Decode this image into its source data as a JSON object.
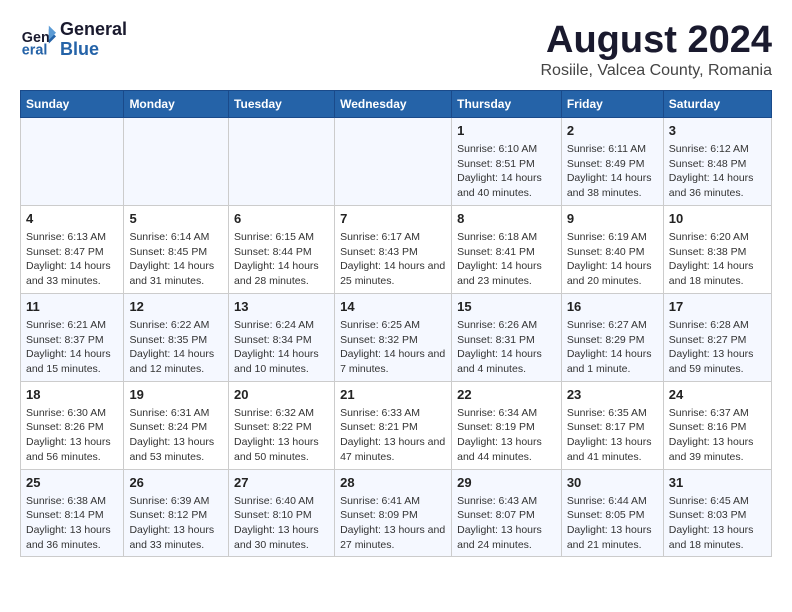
{
  "header": {
    "logo_line1": "General",
    "logo_line2": "Blue",
    "main_title": "August 2024",
    "subtitle": "Rosiile, Valcea County, Romania"
  },
  "days_of_week": [
    "Sunday",
    "Monday",
    "Tuesday",
    "Wednesday",
    "Thursday",
    "Friday",
    "Saturday"
  ],
  "weeks": [
    [
      {
        "day": "",
        "content": ""
      },
      {
        "day": "",
        "content": ""
      },
      {
        "day": "",
        "content": ""
      },
      {
        "day": "",
        "content": ""
      },
      {
        "day": "1",
        "content": "Sunrise: 6:10 AM\nSunset: 8:51 PM\nDaylight: 14 hours and 40 minutes."
      },
      {
        "day": "2",
        "content": "Sunrise: 6:11 AM\nSunset: 8:49 PM\nDaylight: 14 hours and 38 minutes."
      },
      {
        "day": "3",
        "content": "Sunrise: 6:12 AM\nSunset: 8:48 PM\nDaylight: 14 hours and 36 minutes."
      }
    ],
    [
      {
        "day": "4",
        "content": "Sunrise: 6:13 AM\nSunset: 8:47 PM\nDaylight: 14 hours and 33 minutes."
      },
      {
        "day": "5",
        "content": "Sunrise: 6:14 AM\nSunset: 8:45 PM\nDaylight: 14 hours and 31 minutes."
      },
      {
        "day": "6",
        "content": "Sunrise: 6:15 AM\nSunset: 8:44 PM\nDaylight: 14 hours and 28 minutes."
      },
      {
        "day": "7",
        "content": "Sunrise: 6:17 AM\nSunset: 8:43 PM\nDaylight: 14 hours and 25 minutes."
      },
      {
        "day": "8",
        "content": "Sunrise: 6:18 AM\nSunset: 8:41 PM\nDaylight: 14 hours and 23 minutes."
      },
      {
        "day": "9",
        "content": "Sunrise: 6:19 AM\nSunset: 8:40 PM\nDaylight: 14 hours and 20 minutes."
      },
      {
        "day": "10",
        "content": "Sunrise: 6:20 AM\nSunset: 8:38 PM\nDaylight: 14 hours and 18 minutes."
      }
    ],
    [
      {
        "day": "11",
        "content": "Sunrise: 6:21 AM\nSunset: 8:37 PM\nDaylight: 14 hours and 15 minutes."
      },
      {
        "day": "12",
        "content": "Sunrise: 6:22 AM\nSunset: 8:35 PM\nDaylight: 14 hours and 12 minutes."
      },
      {
        "day": "13",
        "content": "Sunrise: 6:24 AM\nSunset: 8:34 PM\nDaylight: 14 hours and 10 minutes."
      },
      {
        "day": "14",
        "content": "Sunrise: 6:25 AM\nSunset: 8:32 PM\nDaylight: 14 hours and 7 minutes."
      },
      {
        "day": "15",
        "content": "Sunrise: 6:26 AM\nSunset: 8:31 PM\nDaylight: 14 hours and 4 minutes."
      },
      {
        "day": "16",
        "content": "Sunrise: 6:27 AM\nSunset: 8:29 PM\nDaylight: 14 hours and 1 minute."
      },
      {
        "day": "17",
        "content": "Sunrise: 6:28 AM\nSunset: 8:27 PM\nDaylight: 13 hours and 59 minutes."
      }
    ],
    [
      {
        "day": "18",
        "content": "Sunrise: 6:30 AM\nSunset: 8:26 PM\nDaylight: 13 hours and 56 minutes."
      },
      {
        "day": "19",
        "content": "Sunrise: 6:31 AM\nSunset: 8:24 PM\nDaylight: 13 hours and 53 minutes."
      },
      {
        "day": "20",
        "content": "Sunrise: 6:32 AM\nSunset: 8:22 PM\nDaylight: 13 hours and 50 minutes."
      },
      {
        "day": "21",
        "content": "Sunrise: 6:33 AM\nSunset: 8:21 PM\nDaylight: 13 hours and 47 minutes."
      },
      {
        "day": "22",
        "content": "Sunrise: 6:34 AM\nSunset: 8:19 PM\nDaylight: 13 hours and 44 minutes."
      },
      {
        "day": "23",
        "content": "Sunrise: 6:35 AM\nSunset: 8:17 PM\nDaylight: 13 hours and 41 minutes."
      },
      {
        "day": "24",
        "content": "Sunrise: 6:37 AM\nSunset: 8:16 PM\nDaylight: 13 hours and 39 minutes."
      }
    ],
    [
      {
        "day": "25",
        "content": "Sunrise: 6:38 AM\nSunset: 8:14 PM\nDaylight: 13 hours and 36 minutes."
      },
      {
        "day": "26",
        "content": "Sunrise: 6:39 AM\nSunset: 8:12 PM\nDaylight: 13 hours and 33 minutes."
      },
      {
        "day": "27",
        "content": "Sunrise: 6:40 AM\nSunset: 8:10 PM\nDaylight: 13 hours and 30 minutes."
      },
      {
        "day": "28",
        "content": "Sunrise: 6:41 AM\nSunset: 8:09 PM\nDaylight: 13 hours and 27 minutes."
      },
      {
        "day": "29",
        "content": "Sunrise: 6:43 AM\nSunset: 8:07 PM\nDaylight: 13 hours and 24 minutes."
      },
      {
        "day": "30",
        "content": "Sunrise: 6:44 AM\nSunset: 8:05 PM\nDaylight: 13 hours and 21 minutes."
      },
      {
        "day": "31",
        "content": "Sunrise: 6:45 AM\nSunset: 8:03 PM\nDaylight: 13 hours and 18 minutes."
      }
    ]
  ]
}
